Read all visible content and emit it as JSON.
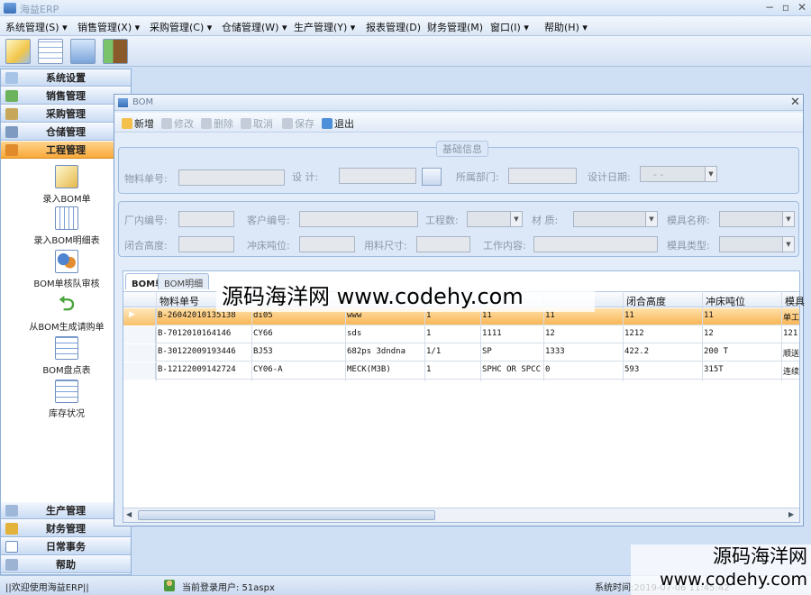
{
  "app": {
    "title": "海益ERP"
  },
  "menu": [
    "系统管理(S)",
    "销售管理(X)",
    "采购管理(C)",
    "仓储管理(W)",
    "生产管理(Y)",
    "报表管理(D)",
    "财务管理(M)",
    "窗口(I)",
    "帮助(H)"
  ],
  "toolbar_icons": [
    "edit-icon",
    "table-icon",
    "report-icon",
    "exit-door-icon"
  ],
  "nav": {
    "sections_top": [
      "系统设置",
      "销售管理",
      "采购管理",
      "仓储管理",
      "工程管理"
    ],
    "active_section": "工程管理",
    "items": [
      "录入BOM单",
      "录入BOM明细表",
      "BOM单核队审核",
      "从BOM生成请购单",
      "BOM盘点表",
      "库存状况"
    ],
    "sections_bottom": [
      "生产管理",
      "财务管理",
      "日常事务",
      "帮助"
    ]
  },
  "bom": {
    "title": "BOM",
    "toolbar": {
      "new": "新增",
      "modify": "修改",
      "delete": "删除",
      "cancel": "取消",
      "save": "保存",
      "exit": "退出"
    },
    "basic_group_title": "基础信息",
    "labels": {
      "material_no": "物料单号:",
      "design": "设    计:",
      "department": "所属部门:",
      "design_date": "设计日期:",
      "factory_no": "厂内编号:",
      "customer_no": "客户编号:",
      "process_count": "工程数:",
      "material": "材  质:",
      "mold_name": "模具名称:",
      "close_height": "闭合高度:",
      "press_tonnage": "冲床吨位:",
      "material_size": "用料尺寸:",
      "work_content": "工作内容:",
      "mold_type": "模具类型:"
    },
    "design_date_value": "-  -"
  },
  "grid": {
    "tabs": [
      "BOM单",
      "BOM明细"
    ],
    "columns": [
      "物料单号",
      "",
      "",
      "",
      "",
      "",
      "闭合高度",
      "冲床吨位",
      "模具"
    ],
    "rows": [
      [
        "B-26042010135138",
        "di05",
        "www",
        "1",
        "11",
        "11",
        "11",
        "11",
        "单工"
      ],
      [
        "B-7012010164146",
        "CY66",
        "sds",
        "1",
        "1111",
        "12",
        "1212",
        "12",
        "121"
      ],
      [
        "B-30122009193446",
        "BJ53",
        "682ps 3dndna",
        "1/1",
        "SP",
        "1333",
        "422.2",
        "200 T",
        "顺送"
      ],
      [
        "B-12122009142724",
        "CY06-A",
        "MECK(M3B)",
        "1",
        "SPHC OR SPCC",
        "0",
        "593",
        "315T",
        "连续"
      ]
    ]
  },
  "status": {
    "welcome": "||欢迎使用海益ERP||",
    "user": "当前登录用户: 51aspx",
    "time": "系统时间:2019-07-06 11:45:42"
  },
  "watermark": {
    "center": "源码海洋网 www.codehy.com",
    "corner_cn": "源码海洋网",
    "corner_url": "www.codehy.com"
  }
}
